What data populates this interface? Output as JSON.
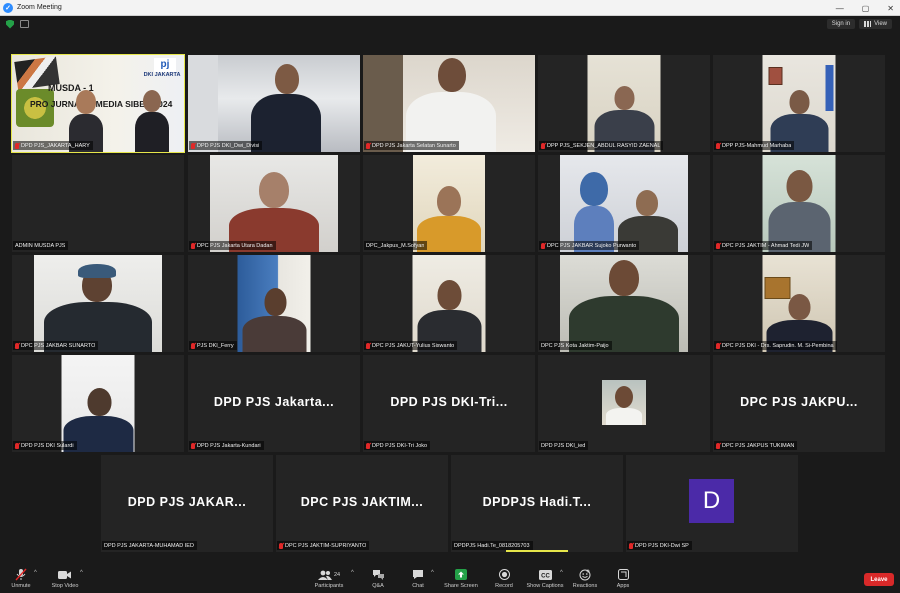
{
  "window": {
    "title": "Zoom Meeting",
    "minimize": "—",
    "maximize": "▢",
    "close": "✕"
  },
  "topbar": {
    "sign_in": "Sign in",
    "view": "View"
  },
  "participants": [
    {
      "name": "DPD PJS_JAKARTA_HARY",
      "muted": true,
      "active": true,
      "banner_line1": "MUSDA - 1",
      "banner_line2": "PRO JURNALIS MEDIA SIBER 2024",
      "banner_logo": "DKI JAKARTA"
    },
    {
      "name": "DPD PJS DKI_Dwi_Divisi",
      "muted": true
    },
    {
      "name": "DPD PJS Jakarta Selatan Sunarto",
      "muted": true
    },
    {
      "name": "DPP PJS_SEKJEN_ABDUL RASYID ZAENAL",
      "muted": true
    },
    {
      "name": "DPP PJS-Mahmud Marhaba",
      "muted": true
    },
    {
      "name": "ADMIN MUSDA PJS",
      "muted": false
    },
    {
      "name": "DPC PJS Jakarta Utara Dadan",
      "muted": true
    },
    {
      "name": "DPC_Jakpus_M.Sofyan",
      "muted": false
    },
    {
      "name": "DPC PJS JAKBAR Sujoko Purwanto",
      "muted": true
    },
    {
      "name": "DPC PJS JAKTIM - Ahmad Tedi JW",
      "muted": true
    },
    {
      "name": "DPC PJS JAKBAR SUNARTO",
      "muted": true
    },
    {
      "name": "PJS DKI_Ferry",
      "muted": true
    },
    {
      "name": "DPC PJS JAKUT-Yulius Siswanto",
      "muted": true
    },
    {
      "name": "DPC PJS Kota Jaktim-Paijo",
      "muted": false
    },
    {
      "name": "DPC PJS DKI - Drs. Saprudin. M. Si-Pembina",
      "muted": true
    },
    {
      "name": "DPD PJS DKI Sulardi",
      "muted": true
    },
    {
      "name": "DPD PJS Jakarta-Kundari",
      "muted": true,
      "display": "DPD PJS Jakarta..."
    },
    {
      "name": "DPD PJS DKI-Tri Joko",
      "muted": true,
      "display": "DPD PJS DKI-Tri..."
    },
    {
      "name": "DPD PJS DKI_ied",
      "muted": false
    },
    {
      "name": "DPC PJS JAKPUS TUKIMAN",
      "muted": true,
      "display": "DPC PJS JAKPU..."
    },
    {
      "name": "DPD PJS JAKARTA-MUHAMAD IED",
      "muted": false,
      "display": "DPD PJS JAKAR..."
    },
    {
      "name": "DPC PJS JAKTIM-SUPRIYANTO",
      "muted": true,
      "display": "DPC PJS JAKTIM..."
    },
    {
      "name": "DPDPJS Hadi.Te_0818205703",
      "muted": false,
      "display": "DPDPJS Hadi.T..."
    },
    {
      "name": "DPD PJS DKI-Dwi SP",
      "muted": true,
      "avatar": "D"
    }
  ],
  "toolbar": {
    "unmute": "Unmute",
    "stop_video": "Stop Video",
    "participants": "Participants",
    "participants_count": "24",
    "qa": "Q&A",
    "chat": "Chat",
    "share_screen": "Share Screen",
    "record": "Record",
    "show_captions": "Show Captions",
    "reactions": "Reactions",
    "apps": "Apps",
    "leave": "Leave"
  },
  "colors": {
    "active_speaker": "#e6e64a",
    "share_green": "#24a148",
    "leave_red": "#d92929",
    "avatar_purple": "#4b2aa8"
  }
}
